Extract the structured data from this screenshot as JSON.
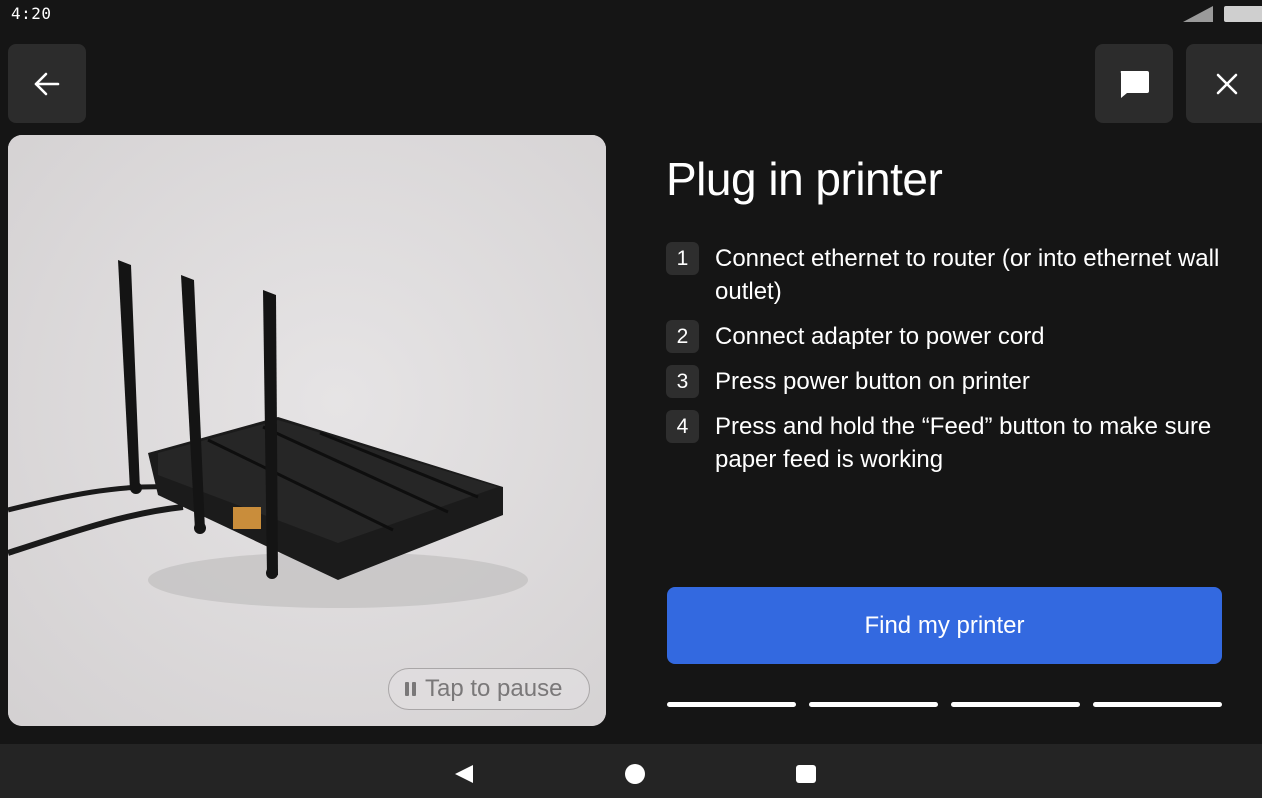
{
  "status_bar": {
    "time": "4:20"
  },
  "header": {
    "back_icon": "arrow-left-icon",
    "chat_icon": "chat-bubble-icon",
    "close_icon": "close-icon"
  },
  "media": {
    "pause_label": "Tap to pause",
    "pause_icon": "pause-icon"
  },
  "title": "Plug in printer",
  "steps": [
    {
      "number": "1",
      "text": "Connect ethernet to router (or into ethernet wall outlet)"
    },
    {
      "number": "2",
      "text": "Connect adapter to power cord"
    },
    {
      "number": "3",
      "text": "Press power button on printer"
    },
    {
      "number": "4",
      "text": "Press and hold the “Feed” button to make sure paper feed is working"
    }
  ],
  "primary_button": {
    "label": "Find my printer",
    "color": "#3369e0"
  },
  "progress": {
    "total": 4,
    "completed": 4
  },
  "nav_bar": {
    "back_icon": "nav-back-icon",
    "home_icon": "nav-home-icon",
    "recents_icon": "nav-recents-icon"
  },
  "colors": {
    "background": "#151515",
    "button_bg": "#2c2c2c",
    "accent": "#3369e0"
  }
}
